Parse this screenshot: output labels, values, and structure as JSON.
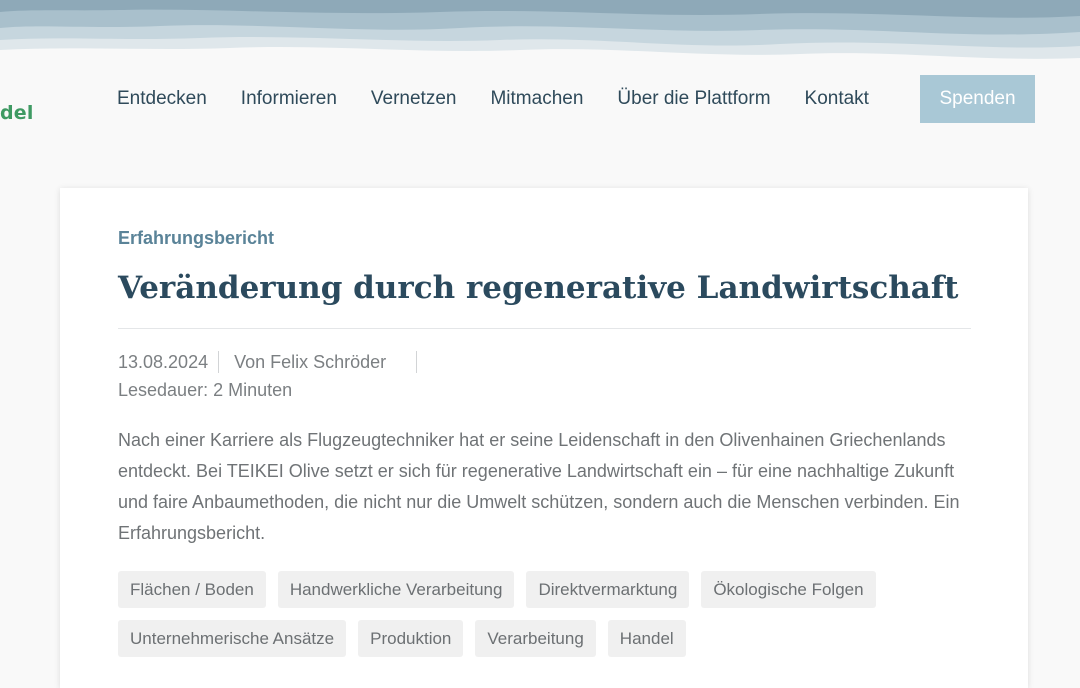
{
  "logo": {
    "text_fragment": "del"
  },
  "nav": {
    "items": [
      "Entdecken",
      "Informieren",
      "Vernetzen",
      "Mitmachen",
      "Über die Plattform",
      "Kontakt"
    ],
    "donate_label": "Spenden"
  },
  "colors": {
    "accent": "#a9c8d6",
    "title": "#2b4a5e",
    "category": "#5a8398",
    "logo": "#3f9a63"
  },
  "article": {
    "category": "Erfahrungsbericht",
    "title": "Veränderung durch regenerative Landwirtschaft",
    "date": "13.08.2024",
    "author": "Von Felix Schröder",
    "reading_time": "Lesedauer: 2 Minuten",
    "excerpt": "Nach einer Karriere als Flugzeugtechniker hat er seine Leidenschaft in den Olivenhainen Griechenlands entdeckt. Bei TEIKEI Olive setzt er sich für regenerative Landwirtschaft ein – für eine nachhaltige Zukunft und faire Anbaumethoden, die nicht nur die Umwelt schützen, sondern auch die Menschen verbinden. Ein Erfahrungsbericht.",
    "tags": [
      "Flächen / Boden",
      "Handwerkliche Verarbeitung",
      "Direktvermarktung",
      "Ökologische Folgen",
      "Unternehmerische Ansätze",
      "Produktion",
      "Verarbeitung",
      "Handel"
    ]
  }
}
